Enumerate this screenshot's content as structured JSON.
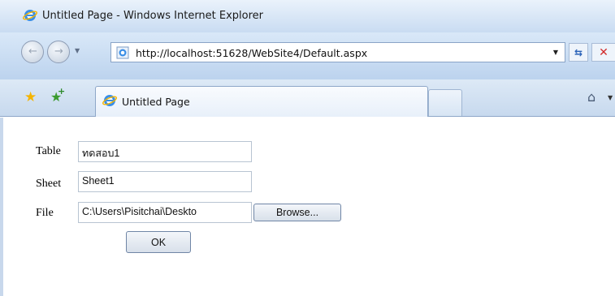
{
  "window": {
    "title": "Untitled Page - Windows Internet Explorer"
  },
  "address_bar": {
    "url": "http://localhost:51628/WebSite4/Default.aspx"
  },
  "tabs": [
    {
      "label": "Untitled Page"
    }
  ],
  "form": {
    "table_label": "Table",
    "table_value": "ทดสอบ1",
    "sheet_label": "Sheet",
    "sheet_value": "Sheet1",
    "file_label": "File",
    "file_value": "C:\\Users\\Pisitchai\\Deskto",
    "browse_label": "Browse...",
    "ok_label": "OK"
  },
  "icons": {
    "ie": "internet-explorer-icon",
    "back": "back-arrow-icon",
    "forward": "forward-arrow-icon",
    "refresh": "refresh-icon",
    "stop": "stop-icon",
    "favorites": "favorites-star-icon",
    "add_favorites": "add-favorites-icon",
    "home": "home-icon"
  },
  "colors": {
    "chrome_blue": "#c9dcf2",
    "accent_blue": "#2a62b8",
    "stop_red": "#d12a2a"
  }
}
